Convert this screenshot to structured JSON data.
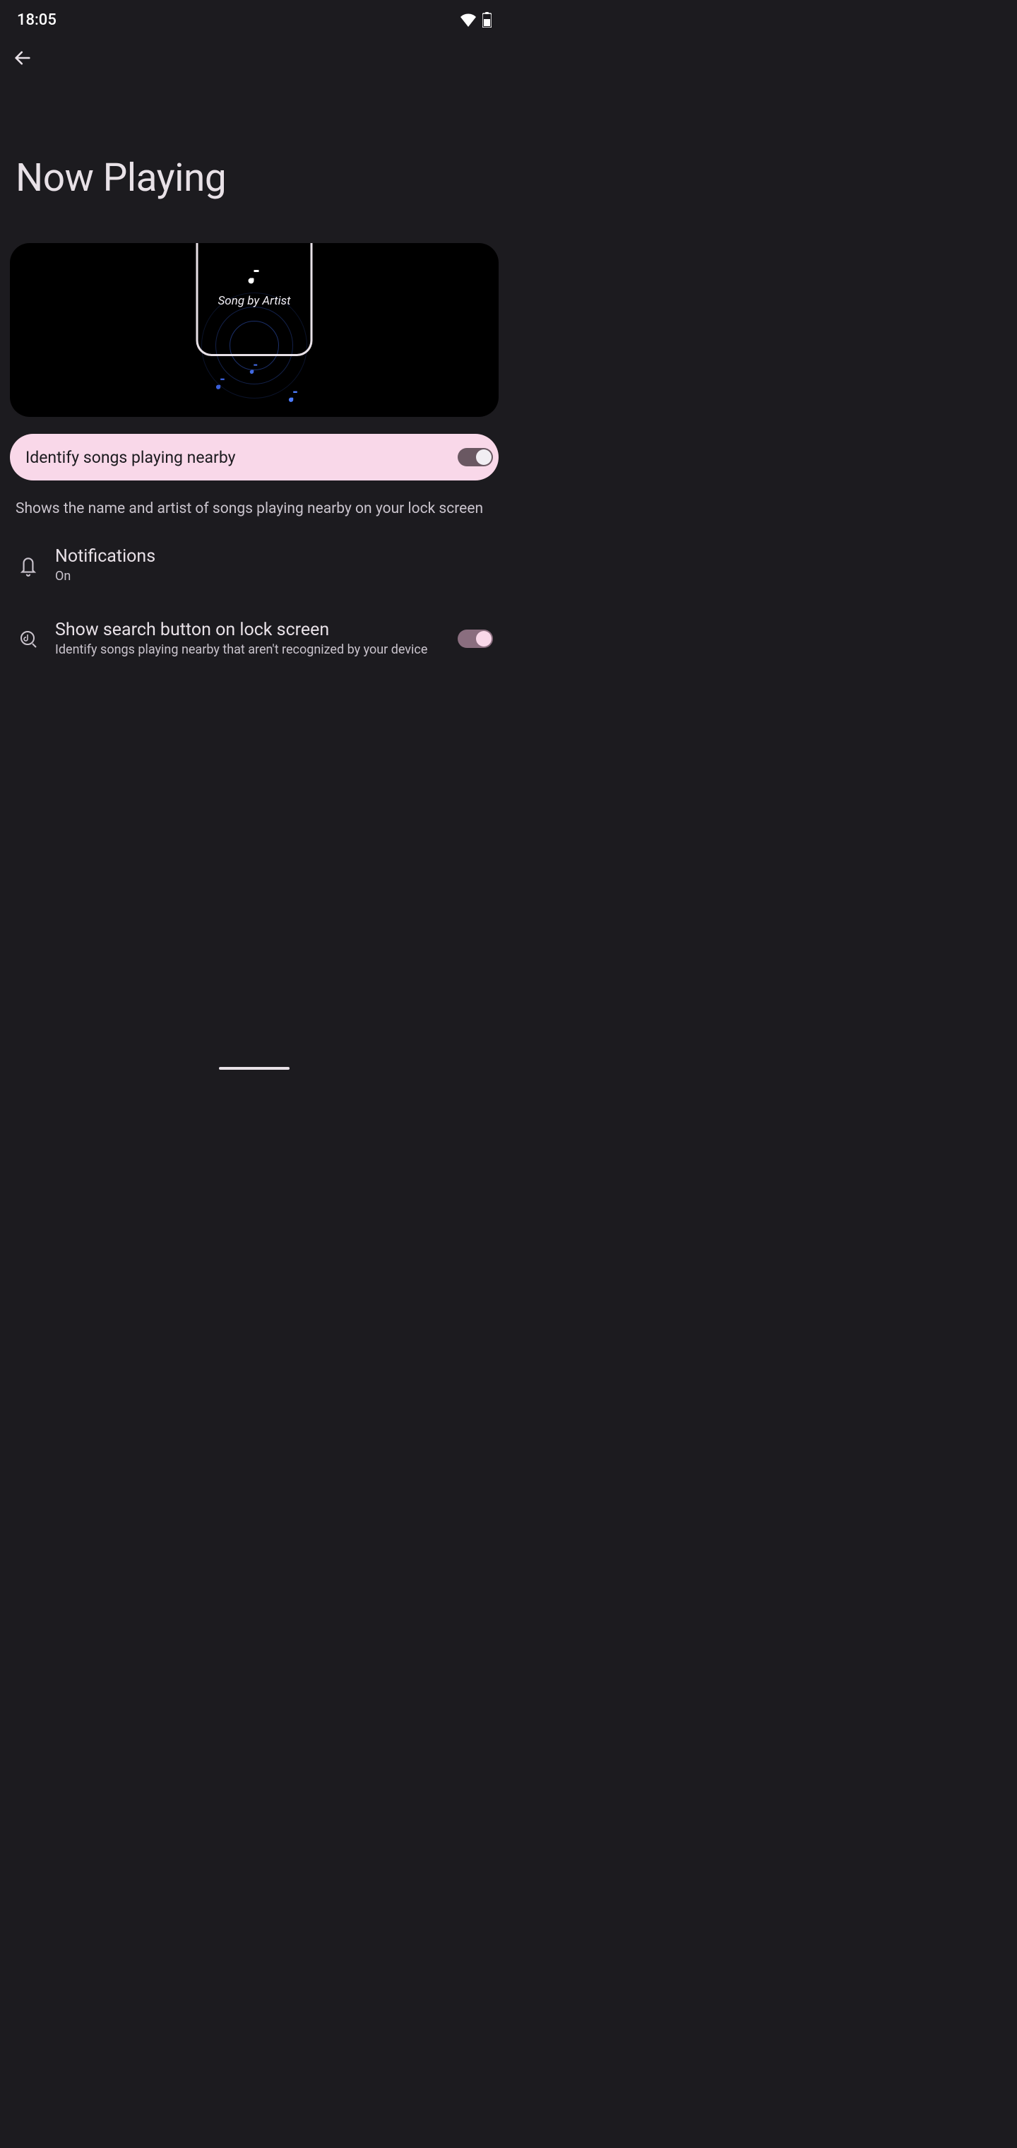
{
  "status": {
    "time": "18:05"
  },
  "page": {
    "title": "Now Playing"
  },
  "illustration": {
    "song_label": "Song by Artist"
  },
  "identify": {
    "label": "Identify songs playing nearby",
    "enabled": true,
    "description": "Shows the name and artist of songs playing nearby on your lock screen"
  },
  "rows": {
    "notifications": {
      "title": "Notifications",
      "subtitle": "On"
    },
    "search_button": {
      "title": "Show search button on lock screen",
      "subtitle": "Identify songs playing nearby that aren't recognized by your device",
      "enabled": true
    }
  }
}
